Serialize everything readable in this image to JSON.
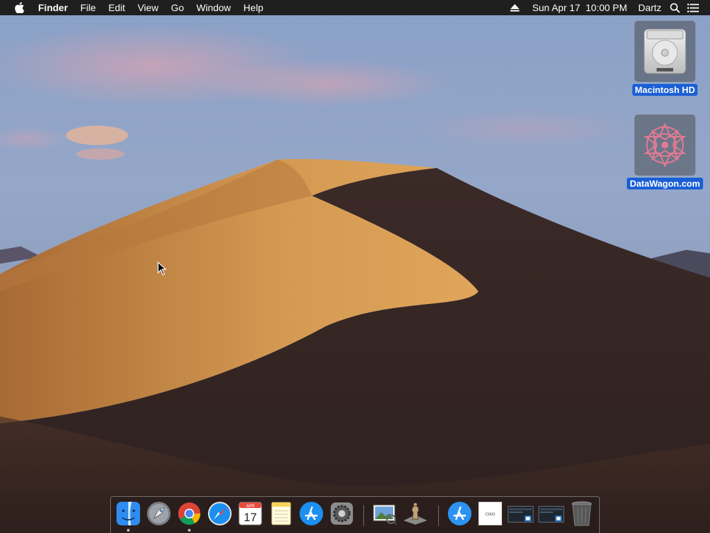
{
  "menubar": {
    "apple_icon": "apple-icon",
    "app_name": "Finder",
    "menus": [
      "File",
      "Edit",
      "View",
      "Go",
      "Window",
      "Help"
    ],
    "eject_icon": "eject-icon",
    "datetime": "Sun Apr 17  10:00 PM",
    "user": "Dartz",
    "spotlight_icon": "search-icon",
    "notification_icon": "list-icon"
  },
  "desktop_icons": [
    {
      "label": "Macintosh HD",
      "icon": "hard-drive-icon"
    },
    {
      "label": "DataWagon.com",
      "icon": "datawagon-logo-icon"
    }
  ],
  "dock": {
    "apps": [
      {
        "name": "Finder",
        "icon": "finder-icon",
        "running": true
      },
      {
        "name": "Launchpad",
        "icon": "launchpad-icon",
        "running": false
      },
      {
        "name": "Google Chrome",
        "icon": "chrome-icon",
        "running": true
      },
      {
        "name": "Safari",
        "icon": "safari-icon",
        "running": false
      },
      {
        "name": "Calendar",
        "icon": "calendar-icon",
        "running": false,
        "month": "APR",
        "day": "17"
      },
      {
        "name": "Notes",
        "icon": "notes-icon",
        "running": false
      },
      {
        "name": "App Store",
        "icon": "app-store-icon",
        "running": false
      },
      {
        "name": "System Preferences",
        "icon": "system-preferences-icon",
        "running": false
      },
      {
        "name": "Preview",
        "icon": "preview-icon",
        "running": false
      },
      {
        "name": "Chess",
        "icon": "chess-icon",
        "running": false
      },
      {
        "name": "Applications",
        "icon": "app-store-icon",
        "running": false
      },
      {
        "name": "Document",
        "icon": "document-icon",
        "running": false,
        "text": "cwo"
      },
      {
        "name": "Screenshot 1",
        "icon": "screenshot-icon",
        "running": false
      },
      {
        "name": "Screenshot 2",
        "icon": "screenshot-icon",
        "running": false
      },
      {
        "name": "Trash",
        "icon": "trash-icon",
        "running": false
      }
    ]
  },
  "colors": {
    "menubar_bg": "#1f1f1f",
    "selection_blue": "#1a5fd6"
  }
}
